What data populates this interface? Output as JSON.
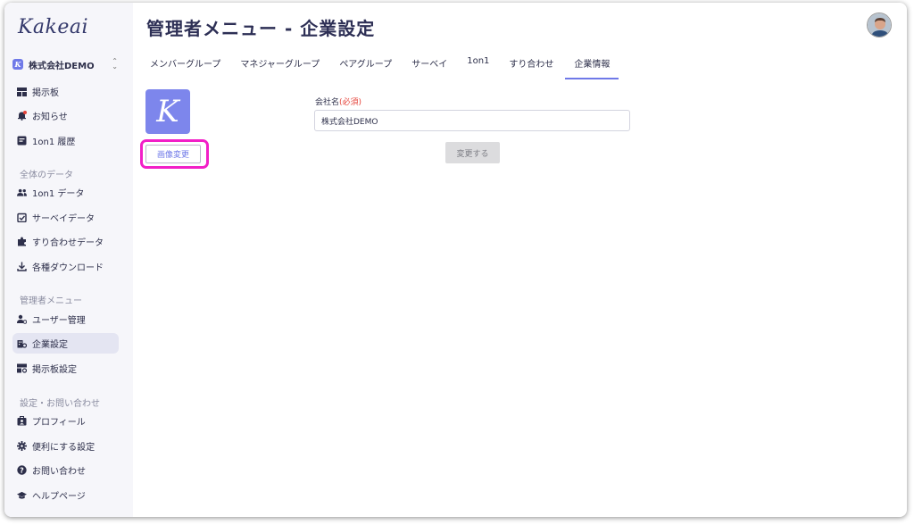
{
  "app": {
    "logo": "Kakeai"
  },
  "company_switcher": {
    "icon_letter": "K",
    "name": "株式会社DEMO"
  },
  "sidebar": {
    "top_items": [
      {
        "label": "掲示板"
      },
      {
        "label": "お知らせ"
      },
      {
        "label": "1on1 履歴"
      }
    ],
    "sections": [
      {
        "title": "全体のデータ",
        "items": [
          {
            "label": "1on1 データ"
          },
          {
            "label": "サーベイデータ"
          },
          {
            "label": "すり合わせデータ"
          },
          {
            "label": "各種ダウンロード"
          }
        ]
      },
      {
        "title": "管理者メニュー",
        "items": [
          {
            "label": "ユーザー管理"
          },
          {
            "label": "企業設定"
          },
          {
            "label": "掲示板設定"
          }
        ]
      },
      {
        "title": "設定・お問い合わせ",
        "items": [
          {
            "label": "プロフィール"
          },
          {
            "label": "便利にする設定"
          },
          {
            "label": "お問い合わせ"
          },
          {
            "label": "ヘルプページ"
          }
        ]
      }
    ]
  },
  "page": {
    "title": "管理者メニュー - 企業設定"
  },
  "tabs": [
    {
      "label": "メンバーグループ"
    },
    {
      "label": "マネジャーグループ"
    },
    {
      "label": "ペアグループ"
    },
    {
      "label": "サーベイ"
    },
    {
      "label": "1on1"
    },
    {
      "label": "すり合わせ"
    },
    {
      "label": "企業情報"
    }
  ],
  "company_form": {
    "logo_letter": "K",
    "change_image_label": "画像変更",
    "name_label": "会社名",
    "required_label": "(必須)",
    "name_value": "株式会社DEMO",
    "submit_label": "変更する"
  },
  "colors": {
    "accent": "#6f79e8",
    "highlight": "#f21fc7",
    "required": "#e5433a"
  }
}
